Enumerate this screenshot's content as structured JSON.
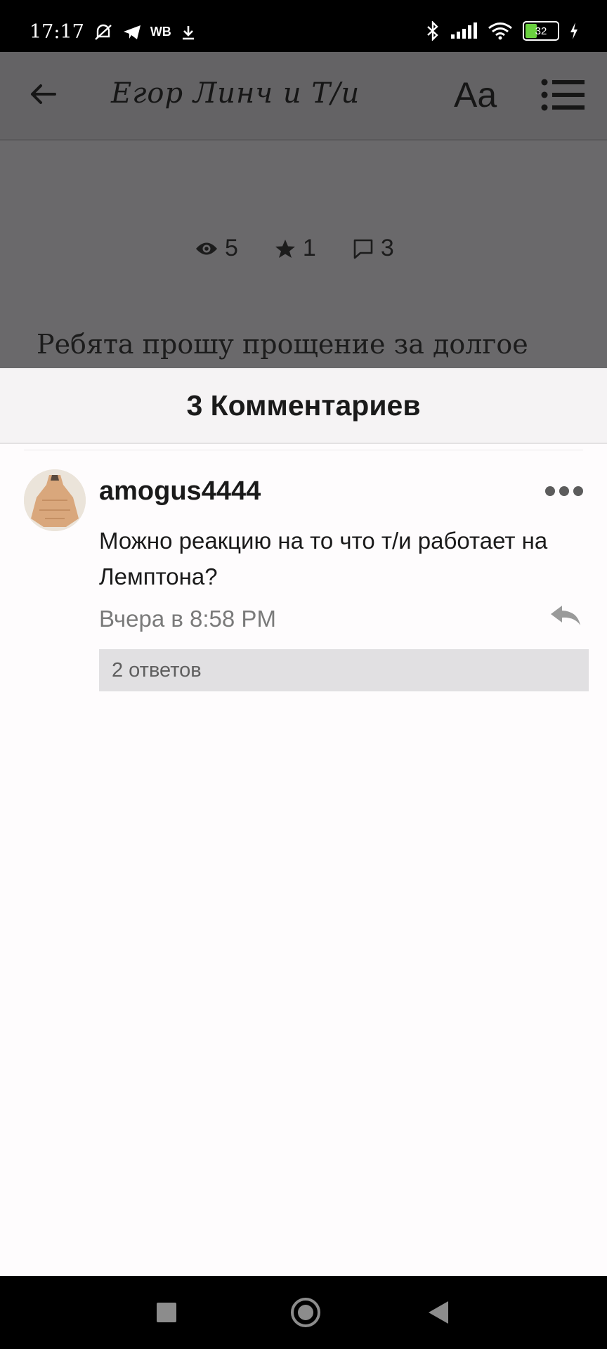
{
  "status_bar": {
    "time": "17:17",
    "carrier_badge": "WB",
    "battery": "32",
    "icons": [
      "mute-icon",
      "telegram-icon",
      "download-icon",
      "bluetooth-icon",
      "signal-icon",
      "wifi-icon",
      "battery-icon",
      "charging-icon"
    ]
  },
  "reader": {
    "title": "Егор Линч и Т/и",
    "font_button": "Aa",
    "stats": {
      "views": "5",
      "stars": "1",
      "comments": "3"
    },
    "story_line": "Ребята прошу прощение за долгое"
  },
  "comments_sheet": {
    "title": "3 Комментариев",
    "comments": [
      {
        "username": "amogus4444",
        "text": "Можно реакцию на то что т/и работает на Лемптона?",
        "time": "Вчера в 8:58 PM",
        "replies": "2 ответов"
      }
    ]
  },
  "colors": {
    "dim_overlay": "#6a696b",
    "sheet_bg": "#fefcfd",
    "replies_bg": "#e1e0e2",
    "battery_fill": "#6ad13f"
  }
}
